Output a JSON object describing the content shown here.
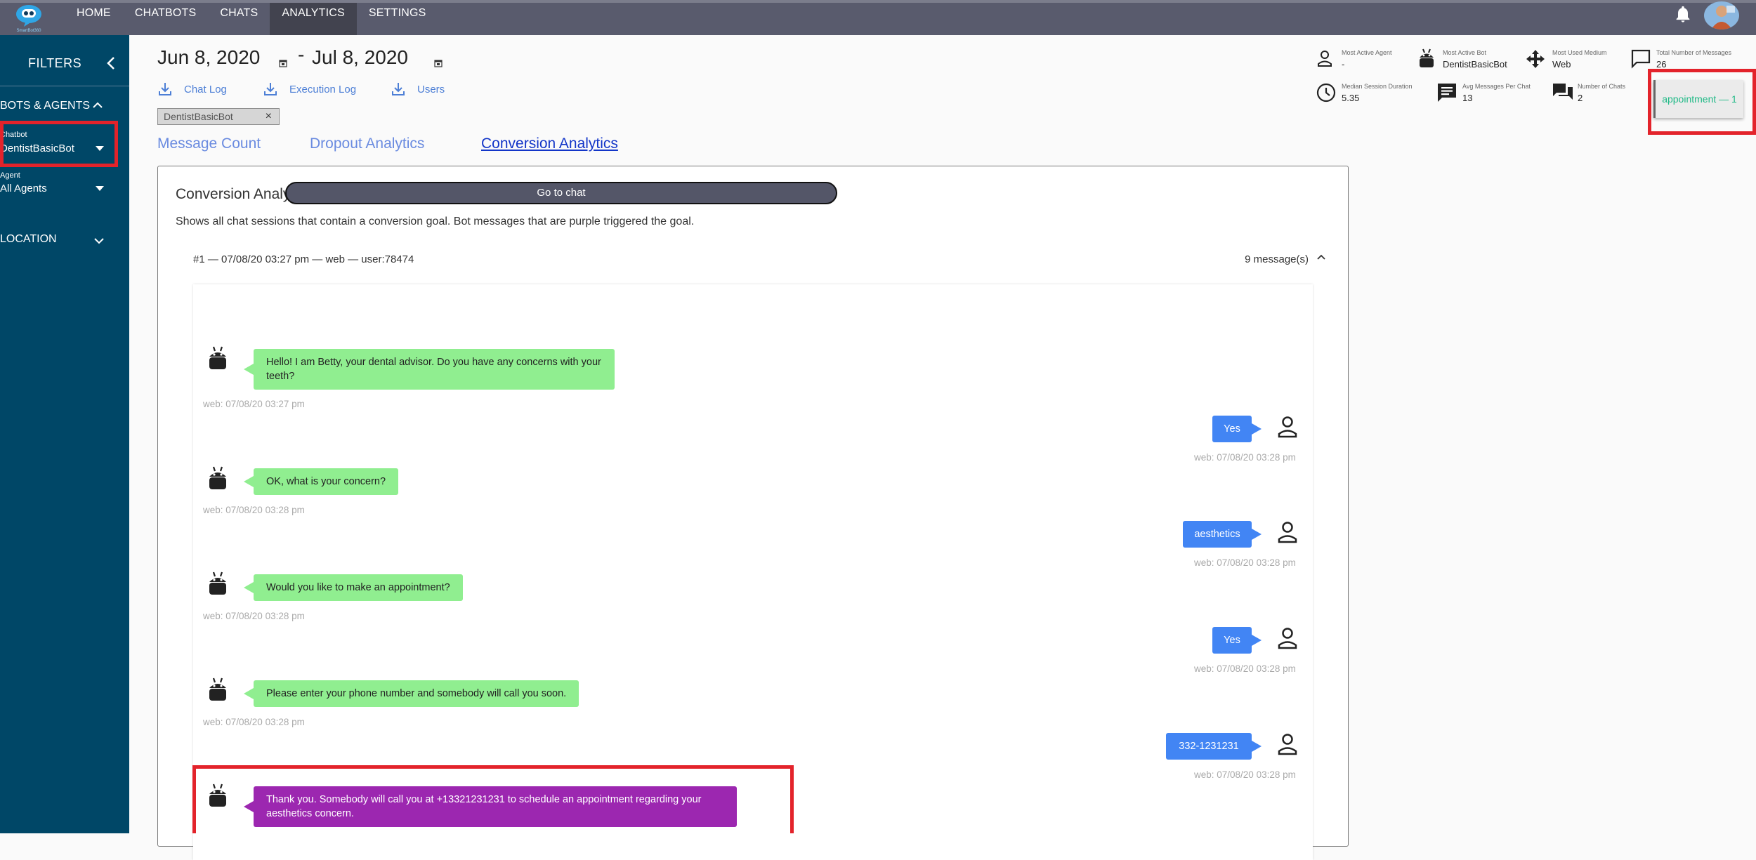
{
  "brand": {
    "logo_text": "SmartBot360"
  },
  "nav": [
    {
      "label": "HOME",
      "active": false
    },
    {
      "label": "CHATBOTS",
      "active": false
    },
    {
      "label": "CHATS",
      "active": false
    },
    {
      "label": "ANALYTICS",
      "active": true
    },
    {
      "label": "SETTINGS",
      "active": false
    }
  ],
  "sidebar": {
    "title": "FILTERS",
    "bots_section": "BOTS & AGENTS",
    "chatbot_label": "Chatbot",
    "chatbot_value": "DentistBasicBot",
    "agent_label": "Agent",
    "agent_value": "All Agents",
    "location_section": "LOCATION"
  },
  "date_range": {
    "start": "Jun 8, 2020",
    "separator": "-",
    "end": "Jul 8, 2020"
  },
  "downloads": {
    "chat_log": "Chat Log",
    "execution_log": "Execution Log",
    "users": "Users"
  },
  "filter_chip": {
    "label": "DentistBasicBot",
    "close": "×"
  },
  "tabs": [
    {
      "label": "Message Count",
      "active": false
    },
    {
      "label": "Dropout Analytics",
      "active": false
    },
    {
      "label": "Conversion Analytics",
      "active": true
    }
  ],
  "stats": {
    "most_active_agent": {
      "label": "Most Active Agent",
      "value": "-"
    },
    "most_active_bot": {
      "label": "Most Active Bot",
      "value": "DentistBasicBot"
    },
    "most_used_medium": {
      "label": "Most Used Medium",
      "value": "Web"
    },
    "total_messages": {
      "label": "Total Number of Messages",
      "value": "26"
    },
    "median_session": {
      "label": "Median Session Duration",
      "value": "5.35"
    },
    "avg_messages": {
      "label": "Avg Messages Per Chat",
      "value": "13"
    },
    "num_chats": {
      "label": "Number of Chats",
      "value": "2"
    }
  },
  "goal": {
    "label": "appointment — 1"
  },
  "panel": {
    "title": "Conversion Analytics",
    "description": "Shows all chat sessions that contain a conversion goal. Bot messages that are purple triggered the goal.",
    "session_header": "#1 — 07/08/20 03:27 pm — web — user:78474",
    "session_count": "9 message(s)",
    "goto_chat": "Go to chat"
  },
  "messages": [
    {
      "from": "bot",
      "text": "Hello! I am Betty, your dental advisor. Do you have any concerns with your teeth?",
      "time": "web: 07/08/20 03:27 pm"
    },
    {
      "from": "user",
      "text": "Yes",
      "time": "web: 07/08/20 03:28 pm"
    },
    {
      "from": "bot",
      "text": "OK, what is your concern?",
      "time": "web: 07/08/20 03:28 pm"
    },
    {
      "from": "user",
      "text": "aesthetics",
      "time": "web: 07/08/20 03:28 pm"
    },
    {
      "from": "bot",
      "text": "Would you like to make an appointment?",
      "time": "web: 07/08/20 03:28 pm"
    },
    {
      "from": "user",
      "text": "Yes",
      "time": "web: 07/08/20 03:28 pm"
    },
    {
      "from": "bot",
      "text": "Please enter your phone number and somebody will call you soon.",
      "time": "web: 07/08/20 03:28 pm"
    },
    {
      "from": "user",
      "text": "332-1231231",
      "time": "web: 07/08/20 03:28 pm"
    },
    {
      "from": "bot",
      "text": "Thank you. Somebody will call you at +13321231231 to schedule an appointment regarding your aesthetics concern.",
      "goal": true
    }
  ],
  "colors": {
    "topbar": "#595b6d",
    "sidebar": "#004767",
    "bot_bubble": "#90ee90",
    "goal_bubble": "#9c27b0",
    "user_bubble": "#4285f4",
    "goal_text": "#1fb986",
    "highlight": "#e3232b"
  }
}
